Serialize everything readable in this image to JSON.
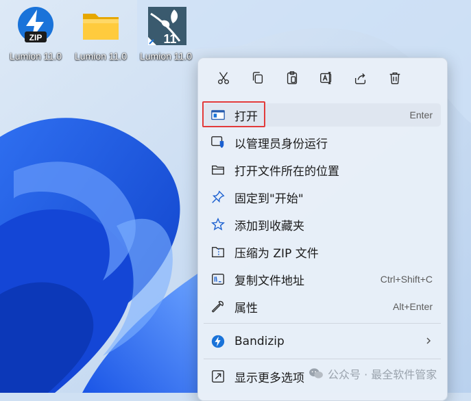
{
  "desktop": {
    "icons": [
      {
        "label": "Lumion 11.0",
        "icon": "zip-archive-icon",
        "badge": "ZIP"
      },
      {
        "label": "Lumion 11.0",
        "icon": "folder-icon"
      },
      {
        "label": "Lumion 11.0",
        "icon": "lumion-app-icon",
        "badge": "11"
      }
    ]
  },
  "context_menu": {
    "toolbar": [
      {
        "icon": "cut-icon",
        "label": "Cut"
      },
      {
        "icon": "copy-icon",
        "label": "Copy"
      },
      {
        "icon": "paste-icon",
        "label": "Paste"
      },
      {
        "icon": "rename-icon",
        "label": "Rename"
      },
      {
        "icon": "share-icon",
        "label": "Share"
      },
      {
        "icon": "delete-icon",
        "label": "Delete"
      }
    ],
    "items": [
      {
        "label": "打开",
        "shortcut": "Enter",
        "icon": "open-window-icon"
      },
      {
        "label": "以管理员身份运行",
        "shortcut": "",
        "icon": "run-as-admin-shield-icon"
      },
      {
        "label": "打开文件所在的位置",
        "shortcut": "",
        "icon": "folder-outline-icon"
      },
      {
        "label": "固定到\"开始\"",
        "shortcut": "",
        "icon": "pin-icon"
      },
      {
        "label": "添加到收藏夹",
        "shortcut": "",
        "icon": "star-icon"
      },
      {
        "label": "压缩为 ZIP 文件",
        "shortcut": "",
        "icon": "zip-folder-icon"
      },
      {
        "label": "复制文件地址",
        "shortcut": "Ctrl+Shift+C",
        "icon": "copy-path-icon"
      },
      {
        "label": "属性",
        "shortcut": "Alt+Enter",
        "icon": "wrench-icon"
      },
      {
        "label": "Bandizip",
        "shortcut": "",
        "icon": "bandizip-icon"
      },
      {
        "label": "显示更多选项",
        "shortcut": "",
        "icon": "more-options-icon"
      }
    ]
  },
  "watermark": {
    "text": "公众号 · 最全软件管家"
  },
  "colors": {
    "highlight_border": "#e23a3a",
    "accent": "#0067c0",
    "menu_bg": "#e8eff8"
  }
}
